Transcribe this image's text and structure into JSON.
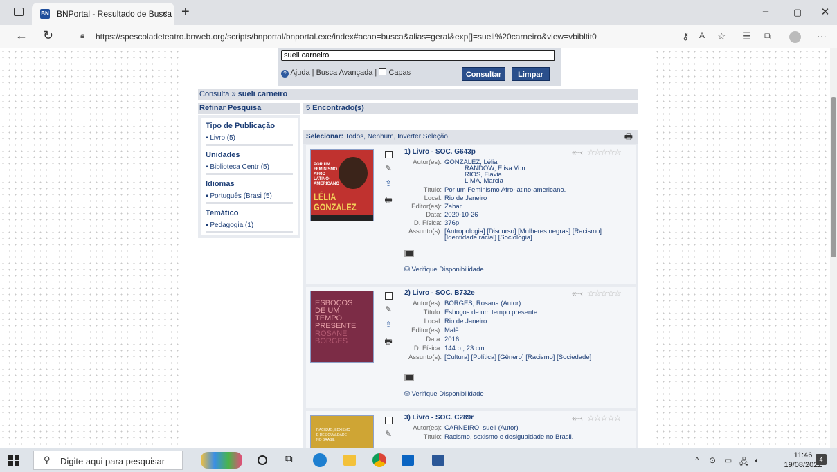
{
  "browser": {
    "tab_title": "BNPortal - Resultado de Busca",
    "tab_close": "×",
    "new_tab": "+",
    "url": "https://spescoladeteatro.bnweb.org/scripts/bnportal/bnportal.exe/index#acao=busca&alias=geral&exp[]=sueli%20carneiro&view=vbibltit0",
    "window_min": "–",
    "window_max": "▢",
    "window_close": "✕",
    "menu": "···"
  },
  "search": {
    "value": "sueli carneiro",
    "help_link": "Ajuda",
    "separator": "|",
    "advanced_link": "Busca Avançada",
    "covers_label": "Capas",
    "submit_label": "Consultar",
    "clear_label": "Limpar"
  },
  "breadcrumb": {
    "prefix": "Consulta »",
    "query": "sueli carneiro"
  },
  "refine": {
    "heading": "Refinar Pesquisa",
    "facets": [
      {
        "title": "Tipo de Publicação",
        "item": "Livro (5)"
      },
      {
        "title": "Unidades",
        "item": "Biblioteca Centr (5)"
      },
      {
        "title": "Idiomas",
        "item": "Português (Brasi (5)"
      },
      {
        "title": "Temático",
        "item": "Pedagogia (1)"
      }
    ]
  },
  "results": {
    "count_label": "5 Encontrado(s)",
    "select_label": "Selecionar:",
    "select_options": "Todos, Nenhum, Inverter Seleção",
    "availability_label": "Verifique Disponibilidade",
    "records": [
      {
        "title": "1) Livro - SOC. G643p",
        "authors_label": "Autor(es):",
        "authors": [
          "GONZALEZ, Lélia",
          "RANDOW, Elisa Von",
          "RIOS, Flavia",
          "LIMA, Marcia"
        ],
        "fields": [
          {
            "label": "Título:",
            "value": "Por um Feminismo Afro-latino-americano."
          },
          {
            "label": "Local:",
            "value": "Rio de Janeiro"
          },
          {
            "label": "Editor(es):",
            "value": "Zahar"
          },
          {
            "label": "Data:",
            "value": "2020-10-26"
          },
          {
            "label": "D. Física:",
            "value": "376p."
          },
          {
            "label": "Assunto(s):",
            "value": "[Antropologia] [Discurso] [Mulheres negras] [Racismo]"
          }
        ],
        "subjects_cont": "[Identidade racial] [Sociologia]",
        "cover_lines": [
          "POR UM",
          "FEMINISMO",
          "AFRO",
          "LATINO-",
          "AMERICANO",
          "LÉLIA",
          "GONZALEZ"
        ]
      },
      {
        "title": "2) Livro - SOC. B732e",
        "authors_label": "Autor(es):",
        "authors": [
          "BORGES, Rosana (Autor)"
        ],
        "fields": [
          {
            "label": "Título:",
            "value": "Esboços de um tempo presente."
          },
          {
            "label": "Local:",
            "value": "Rio de Janeiro"
          },
          {
            "label": "Editor(es):",
            "value": "Malê"
          },
          {
            "label": "Data:",
            "value": "2016"
          },
          {
            "label": "D. Física:",
            "value": "144 p.; 23 cm"
          },
          {
            "label": "Assunto(s):",
            "value": "[Cultura] [Política] [Gênero] [Racismo] [Sociedade]"
          }
        ],
        "cover_lines": [
          "ESBOÇOS",
          "DE UM",
          "TEMPO",
          "PRESENTE",
          "ROSANE",
          "BORGES"
        ]
      },
      {
        "title": "3) Livro - SOC. C289r",
        "authors_label": "Autor(es):",
        "authors": [
          "CARNEIRO, sueli (Autor)"
        ],
        "fields": [
          {
            "label": "Título:",
            "value": "Racismo, sexismo e desigualdade no Brasil."
          }
        ],
        "cover_lines": [
          "RACISMO, SEXISMO",
          "E DESIGUALDADE",
          "NO BRASIL"
        ]
      }
    ]
  },
  "taskbar": {
    "search_placeholder": "Digite aqui para pesquisar",
    "time": "11:46",
    "date": "19/08/2022",
    "notification_count": "4"
  },
  "colors": {
    "link": "#1d3e76",
    "button": "#2a4f8c",
    "panel": "#dcdfe5",
    "cover1_bg": "#c0322f",
    "cover1_text": "#f3d25a",
    "cover2_bg": "#7c2c46",
    "cover3_bg": "#cfa534"
  }
}
